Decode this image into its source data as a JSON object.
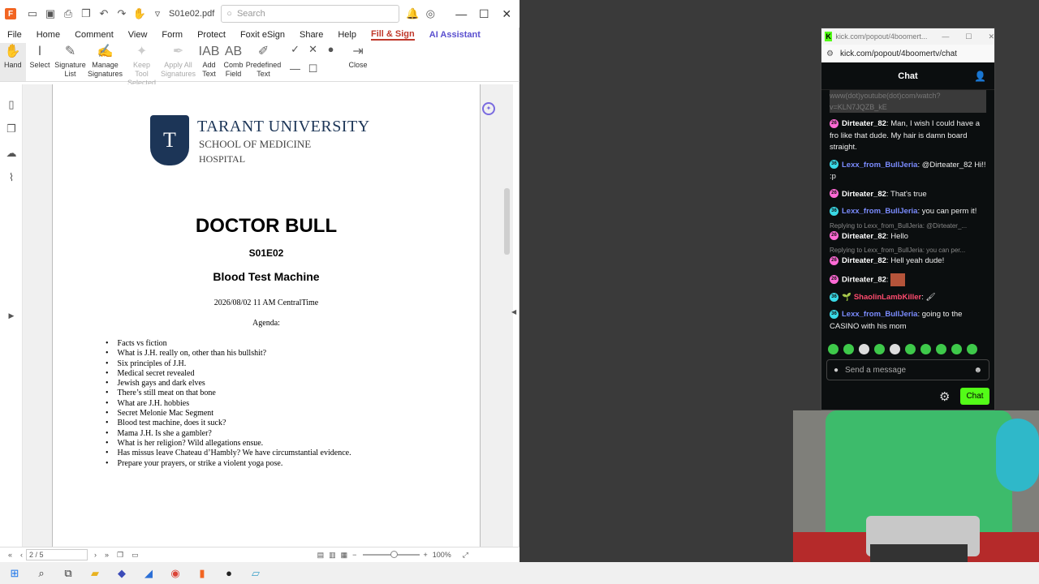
{
  "pdf": {
    "filename": "S01e02.pdf",
    "search_placeholder": "Search",
    "menu": [
      "File",
      "Home",
      "Comment",
      "View",
      "Form",
      "Protect",
      "Foxit eSign",
      "Share",
      "Help",
      "Fill & Sign",
      "AI Assistant"
    ],
    "ribbon": [
      {
        "label": "Hand",
        "icon": "hand-icon",
        "enabled": true
      },
      {
        "label": "Select",
        "icon": "select-icon",
        "enabled": true
      },
      {
        "label": "Signature List",
        "icon": "signature-list-icon",
        "enabled": true
      },
      {
        "label": "Manage Signatures",
        "icon": "manage-signatures-icon",
        "enabled": true
      },
      {
        "label": "Keep Tool Selected",
        "icon": "keep-tool-icon",
        "enabled": false
      },
      {
        "label": "Apply All Signatures",
        "icon": "apply-all-icon",
        "enabled": false
      },
      {
        "label": "Add Text",
        "icon": "add-text-icon",
        "enabled": true
      },
      {
        "label": "Comb Field",
        "icon": "comb-field-icon",
        "enabled": true
      },
      {
        "label": "Predefined Text",
        "icon": "predefined-text-icon",
        "enabled": true
      },
      {
        "label": "Close",
        "icon": "close-icon",
        "enabled": true
      }
    ],
    "page_indicator": "2 / 5",
    "zoom": "100%"
  },
  "doc": {
    "uni_line1": "TARANT UNIVERSITY",
    "uni_line2": "SCHOOL OF MEDICINE",
    "uni_line3": "HOSPITAL",
    "title": "DOCTOR BULL",
    "episode": "S01E02",
    "subtitle": "Blood Test Machine",
    "datetime": "2026/08/02 11 AM CentralTime",
    "agenda_label": "Agenda:",
    "agenda": [
      "Facts vs fiction",
      "What is J.H. really on, other than his bullshit?",
      "Six principles of J.H.",
      "Medical secret revealed",
      "Jewish gays and dark elves",
      "There’s still meat on that bone",
      "What are J.H. hobbies",
      "Secret Melonie Mac Segment",
      "Blood test machine, does it suck?",
      "Mama J.H. Is she a gambler?",
      "What is her religion? Wild allegations ensue.",
      "Has missus leave Chateau d’Hambly? We have circumstantial evidence.",
      "Prepare your prayers, or strike a violent yoga pose."
    ]
  },
  "chat": {
    "tab_title": "kick.com/popout/4boomert...",
    "url": "kick.com/popout/4boomertv/chat",
    "header": "Chat",
    "faded_top": "www(dot)youtube(dot)com/watch?v=KLN7JQZB_kE",
    "messages": [
      {
        "user": "Dirteater_82",
        "text": "Man, I wish I could have a fro like that dude. My hair is damn board straight.",
        "cls": "u1",
        "badge": "26",
        "badge_color": "#ff6ad5"
      },
      {
        "user": "Lexx_from_BullJeria",
        "text": "@Dirteater_82 Hi!! :p",
        "cls": "u2",
        "badge": "36",
        "badge_color": "#39d9e6"
      },
      {
        "user": "Dirteater_82",
        "text": "That's true",
        "cls": "u1",
        "badge": "26",
        "badge_color": "#ff6ad5"
      },
      {
        "user": "Lexx_from_BullJeria",
        "text": "you can perm it!",
        "cls": "u2",
        "badge": "36",
        "badge_color": "#39d9e6"
      },
      {
        "reply": "Replying to Lexx_from_BullJeria: @Dirteater_...",
        "user": "Dirteater_82",
        "text": "Hello",
        "cls": "u1",
        "badge": "26",
        "badge_color": "#ff6ad5"
      },
      {
        "reply": "Replying to Lexx_from_BullJeria: you can per...",
        "user": "Dirteater_82",
        "text": "Hell yeah dude!",
        "cls": "u1",
        "badge": "26",
        "badge_color": "#ff6ad5"
      },
      {
        "user": "Dirteater_82",
        "text": "",
        "cls": "u1",
        "badge": "26",
        "badge_color": "#ff6ad5"
      },
      {
        "user": "ShaolinLambKiller",
        "text": "",
        "cls": "u3",
        "badge": "36",
        "badge_color": "#39d9e6"
      },
      {
        "user": "Lexx_from_BullJeria",
        "text": "going to the CASINO with his mom",
        "cls": "u2",
        "badge": "36",
        "badge_color": "#39d9e6"
      }
    ],
    "input_placeholder": "Send a message",
    "send_label": "Chat"
  },
  "colors": {
    "accent": "#c0392b",
    "kick_green": "#53fc18"
  }
}
